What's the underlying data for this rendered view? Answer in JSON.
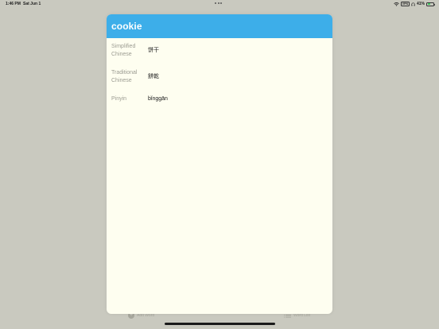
{
  "status_bar": {
    "time": "1:46 PM",
    "date": "Sat Jun 1",
    "vpn_label": "VPN",
    "battery_percent": "41%",
    "battery_level": 0.41,
    "icons": [
      "wifi-icon",
      "headphones-icon",
      "battery-icon"
    ]
  },
  "modal": {
    "title": "cookie",
    "header_color": "#3daee9",
    "background_color": "#fefef0",
    "fields": [
      {
        "label": "Simplified Chinese",
        "value": "饼干"
      },
      {
        "label": "Traditional Chinese",
        "value": "餅乾"
      },
      {
        "label": "Pinyin",
        "value": "bǐnggān"
      }
    ]
  },
  "tab_bar": {
    "items": [
      {
        "label": "Add Word",
        "icon": "plus-circle-icon"
      },
      {
        "label": "Word List",
        "icon": "list-icon"
      }
    ]
  }
}
